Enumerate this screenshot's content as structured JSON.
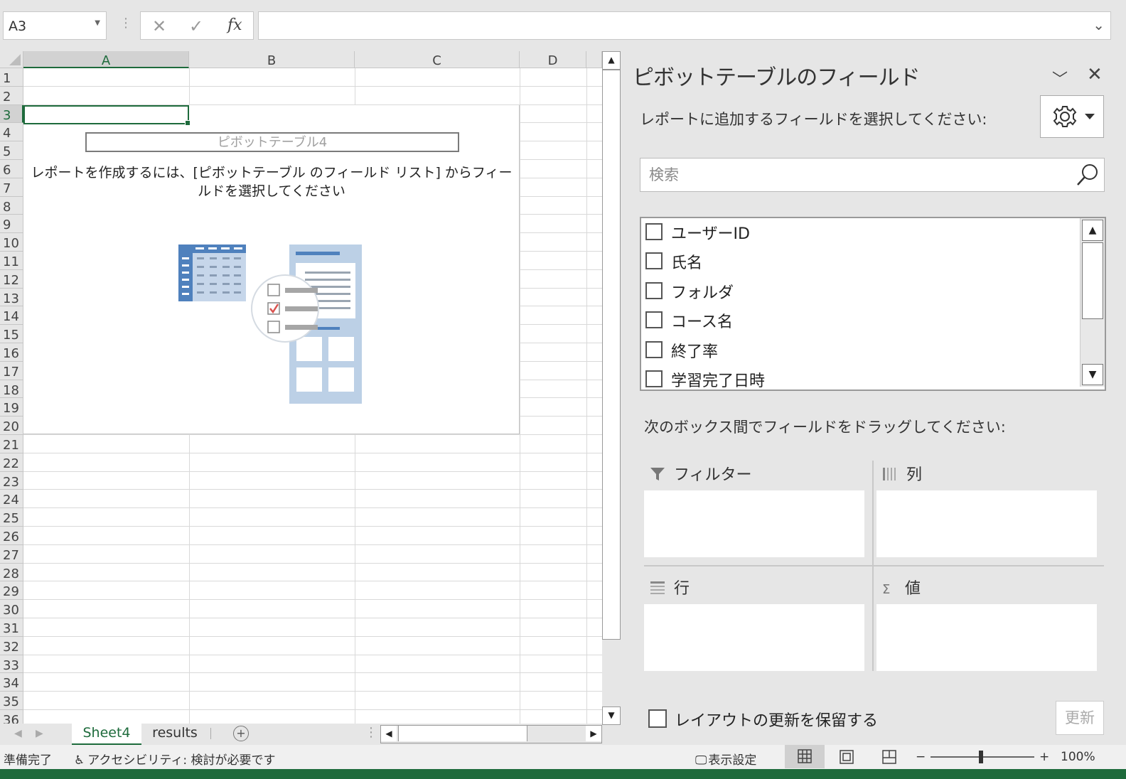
{
  "formula_bar": {
    "name_box": "A3",
    "cancel_icon": "✕",
    "enter_icon": "✓",
    "fx_icon": "fx",
    "formula_value": ""
  },
  "grid": {
    "columns": [
      "A",
      "B",
      "C",
      "D"
    ],
    "selected_column": "A",
    "rows": [
      "1",
      "2",
      "3",
      "4",
      "5",
      "6",
      "7",
      "8",
      "9",
      "10",
      "11",
      "12",
      "13",
      "14",
      "15",
      "16",
      "17",
      "18",
      "19",
      "20",
      "21",
      "22",
      "23",
      "24",
      "25",
      "26",
      "27",
      "28",
      "29",
      "30",
      "31",
      "32",
      "33",
      "34",
      "35",
      "36"
    ],
    "selected_row": "3",
    "active_cell": "A3"
  },
  "pivot_placeholder": {
    "name": "ピボットテーブル4",
    "message": "レポートを作成するには、[ピボットテーブル のフィールド リスト] からフィールドを選択してください"
  },
  "sheet_tabs": {
    "tabs": [
      "Sheet4",
      "results"
    ],
    "active_tab": "Sheet4"
  },
  "status_bar": {
    "ready": "準備完了",
    "accessibility": "アクセシビリティ: 検討が必要です",
    "display_settings": "表示設定",
    "zoom_minus": "−",
    "zoom_plus": "+",
    "zoom_level": "100%"
  },
  "pivot_pane": {
    "title": "ピボットテーブルのフィールド",
    "field_prompt": "レポートに追加するフィールドを選択してください:",
    "search_placeholder": "検索",
    "fields": [
      {
        "label": "ユーザーID",
        "checked": false
      },
      {
        "label": "氏名",
        "checked": false
      },
      {
        "label": "フォルダ",
        "checked": false
      },
      {
        "label": "コース名",
        "checked": false
      },
      {
        "label": "終了率",
        "checked": false
      },
      {
        "label": "学習完了日時",
        "checked": false
      }
    ],
    "drag_prompt": "次のボックス間でフィールドをドラッグしてください:",
    "areas": {
      "filter": "フィルター",
      "columns": "列",
      "rows": "行",
      "values": "値"
    },
    "defer_label": "レイアウトの更新を保留する",
    "update_button": "更新"
  },
  "colors": {
    "accent": "#1e6b3c",
    "chrome": "#e6e6e6"
  }
}
